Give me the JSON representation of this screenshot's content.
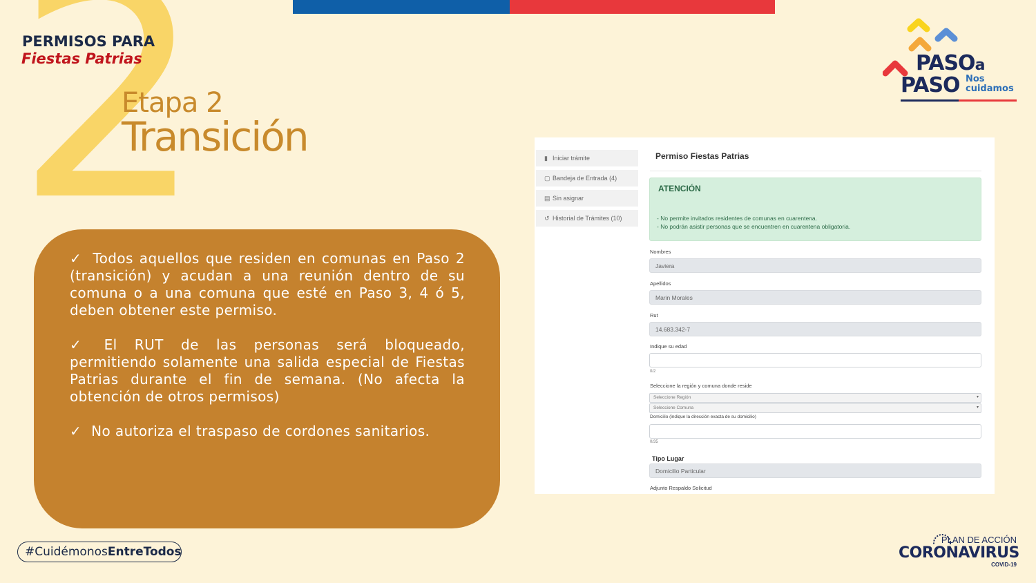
{
  "header": {
    "big_number": "2",
    "title_line1": "PERMISOS PARA",
    "title_line2": "Fiestas Patrias",
    "stage_label": "Etapa 2",
    "stage_name": "Transición"
  },
  "bullets": [
    "Todos aquellos que residen en comunas en Paso 2 (transición) y acudan a una reunión dentro de su comuna o a una comuna que esté en Paso 3, 4 ó 5, deben obtener este permiso.",
    "El RUT de las personas será bloqueado, permitiendo solamente una salida especial de Fiestas Patrias durante el fin de semana. (No afecta la obtención de otros permisos)",
    "No autoriza el traspaso de cordones sanitarios."
  ],
  "check_glyph": "✓",
  "hashtag": {
    "prefix": "#Cuidémonos",
    "bold": "EntreTodos"
  },
  "logo": {
    "paso1": "PASO",
    "a": "a",
    "paso2": "PASO",
    "nos": "Nos",
    "cuidamos": "cuidamos"
  },
  "plan": {
    "top": "PLAN DE ACCIÓN",
    "main": "CORONAVIRUS",
    "sub": "COVID-19"
  },
  "screenshot": {
    "sidebar": [
      {
        "icon": "file-icon",
        "glyph": "▮",
        "label": "Iniciar trámite"
      },
      {
        "icon": "inbox-icon",
        "glyph": "▢",
        "label": "Bandeja de Entrada (4)"
      },
      {
        "icon": "unassigned-icon",
        "glyph": "▤",
        "label": "Sin asignar"
      },
      {
        "icon": "history-icon",
        "glyph": "↺",
        "label": "Historial de Trámites (10)"
      }
    ],
    "form_title": "Permiso Fiestas Patrias",
    "alert": {
      "title": "ATENCIÓN",
      "line1": "- No permite invitados residentes de comunas en cuarentena.",
      "line2": "- No podrán asistir personas que se encuentren en cuarentena obligatoria."
    },
    "fields": {
      "nombres_label": "Nombres",
      "nombres_value": "Javiera",
      "apellidos_label": "Apellidos",
      "apellidos_value": "Marin Morales",
      "rut_label": "Rut",
      "rut_value": "14.683.342-7",
      "edad_label": "Indique su edad",
      "edad_counter": "0/2",
      "region_label": "Seleccione la región y comuna donde reside",
      "region_select": "Seleccione Región",
      "comuna_select": "Seleccione Comuna",
      "domicilio_label": "Domicilio (indique la dirección exacta de su domicilio)",
      "domicilio_counter": "0/35",
      "tipo_lugar_label": "Tipo Lugar",
      "tipo_lugar_value": "Domicilio Particular",
      "adjunto_label": "Adjunto Respaldo Solicitud"
    }
  },
  "colors": {
    "background": "#fdf3d8",
    "accent_yellow": "#f9d567",
    "panel_orange": "#c5822e",
    "title_gold": "#c88a2c",
    "navy": "#1c2a48",
    "red": "#c0141c",
    "flag_blue": "#0f5fa8",
    "flag_red": "#e8383c"
  }
}
